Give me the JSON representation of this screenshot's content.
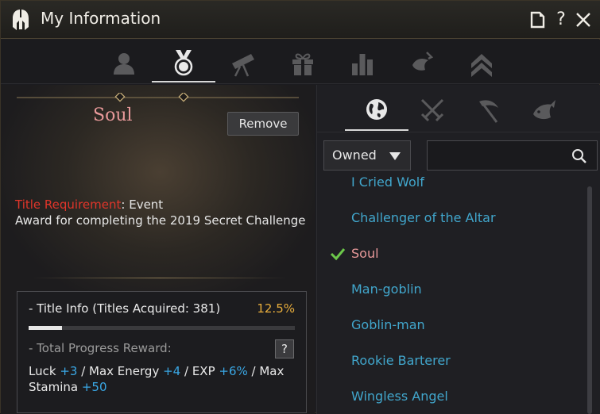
{
  "window": {
    "title": "My Information",
    "logo_icon": "spartan-helmet-icon",
    "buttons": [
      {
        "name": "document-icon"
      },
      {
        "name": "help-icon",
        "label": "?"
      },
      {
        "name": "close-icon"
      }
    ]
  },
  "top_tabs": [
    {
      "name": "profile-icon",
      "active": false
    },
    {
      "name": "medal-icon",
      "active": true
    },
    {
      "name": "telescope-icon",
      "active": false
    },
    {
      "name": "gift-icon",
      "active": false
    },
    {
      "name": "bar-chart-icon",
      "active": false
    },
    {
      "name": "fish-hook-icon",
      "active": false
    },
    {
      "name": "double-chevron-up-icon",
      "active": false
    }
  ],
  "selected_title": {
    "name": "Soul",
    "remove_label": "Remove",
    "requirement_label": "Title Requirement",
    "requirement_sep": ": ",
    "requirement_value": "Event",
    "description": "Award for completing the 2019 Secret Challenge"
  },
  "title_info": {
    "header": "- Title Info (Titles Acquired: 381)",
    "percent": "12.5%",
    "progress_fraction": 0.125,
    "reward_header": "- Total Progress Reward:",
    "help_label": "?",
    "rewards": [
      {
        "label": "Luck ",
        "bonus": "+3",
        "sep": " / "
      },
      {
        "label": "Max Energy ",
        "bonus": "+4",
        "sep": " / "
      },
      {
        "label": "EXP ",
        "bonus": "+6%",
        "sep": " / "
      },
      {
        "label": "Max Stamina ",
        "bonus": "+50",
        "sep": ""
      }
    ]
  },
  "sub_tabs": [
    {
      "name": "globe-icon",
      "active": true
    },
    {
      "name": "crossed-swords-icon",
      "active": false
    },
    {
      "name": "scythe-icon",
      "active": false
    },
    {
      "name": "fish-icon",
      "active": false
    }
  ],
  "filter": {
    "selected": "Owned"
  },
  "search": {
    "placeholder": ""
  },
  "titles": [
    {
      "label": "I Cried Wolf",
      "selected": false
    },
    {
      "label": "Challenger of the Altar",
      "selected": false
    },
    {
      "label": "Soul",
      "selected": true
    },
    {
      "label": "Man-goblin",
      "selected": false
    },
    {
      "label": "Goblin-man",
      "selected": false
    },
    {
      "label": "Rookie Barterer",
      "selected": false
    },
    {
      "label": "Wingless Angel",
      "selected": false
    }
  ],
  "colors": {
    "selected_title": "#e8999a",
    "requirement_label": "#e0352a",
    "percent": "#e7ad3c",
    "bonus": "#3aa8e6",
    "list_item": "#41a6cc",
    "check": "#6cc84a"
  }
}
